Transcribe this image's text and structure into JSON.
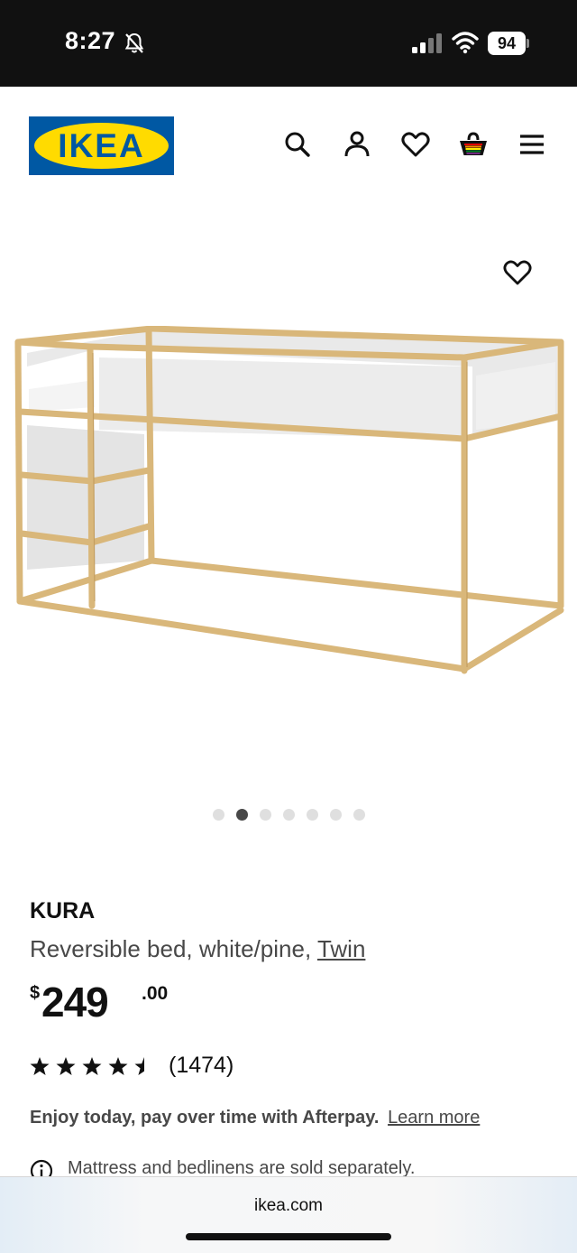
{
  "status_bar": {
    "time": "8:27",
    "battery": "94",
    "icons": [
      "bell-muted-icon",
      "signal-icon",
      "wifi-icon",
      "battery-icon"
    ]
  },
  "header": {
    "logo_text": "IKEA",
    "icons": [
      "search-icon",
      "account-icon",
      "wishlist-icon",
      "cart-icon",
      "menu-icon"
    ]
  },
  "gallery": {
    "image_count": 7,
    "active_index": 1,
    "favorite_icon": "heart-outline-icon"
  },
  "product": {
    "name": "KURA",
    "description": "Reversible bed, white/pine, ",
    "size": "Twin",
    "price": {
      "currency": "$",
      "integer": "249",
      "decimal": ".00"
    },
    "rating": 4.5,
    "review_count": "(1474)"
  },
  "afterpay": {
    "text": "Enjoy today, pay over time with Afterpay.",
    "link": "Learn more"
  },
  "notice": {
    "icon": "info-icon",
    "text": "Mattress and bedlinens are sold separately."
  },
  "browser": {
    "url": "ikea.com"
  },
  "colors": {
    "brand_blue": "#0058a3",
    "brand_yellow": "#ffdb00",
    "text_primary": "#111111",
    "text_secondary": "#484848"
  }
}
